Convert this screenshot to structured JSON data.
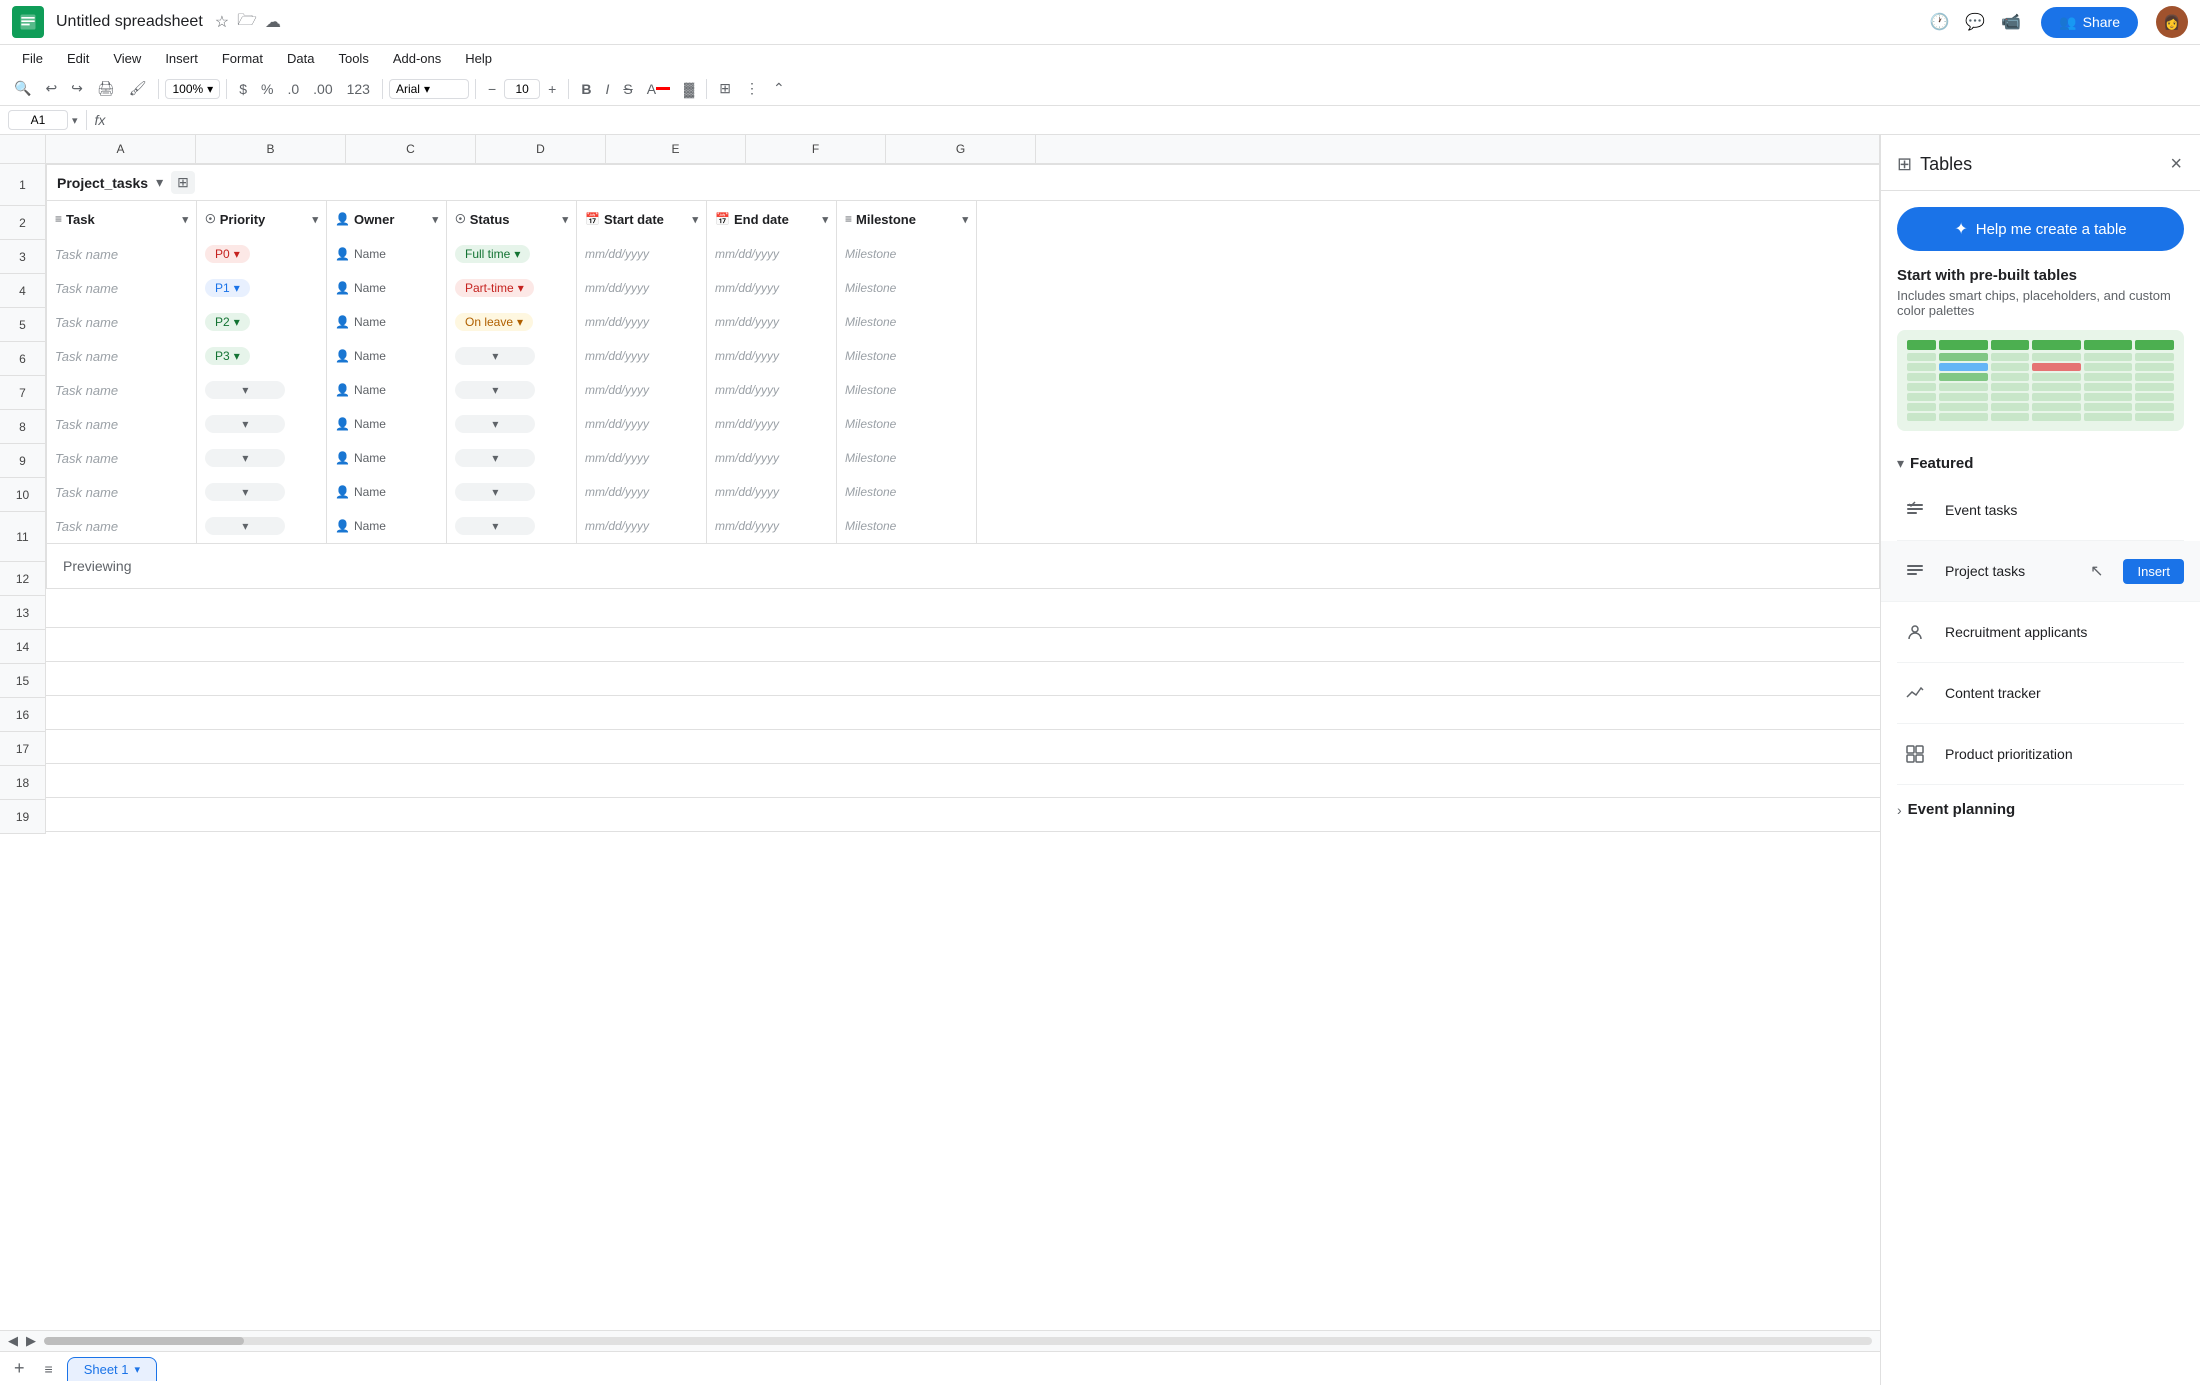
{
  "app": {
    "title": "Untitled spreadsheet",
    "icon_bg": "#0f9d58"
  },
  "menu": {
    "items": [
      "File",
      "Edit",
      "View",
      "Insert",
      "Format",
      "Data",
      "Tools",
      "Add-ons",
      "Help"
    ]
  },
  "toolbar": {
    "zoom": "100%",
    "font": "Arial",
    "font_size": "10",
    "bold": "B",
    "italic": "I",
    "strikethrough": "S̶",
    "more": "⋮"
  },
  "formula_bar": {
    "cell_ref": "A1",
    "fx": "fx"
  },
  "col_headers": [
    "",
    "A",
    "B",
    "C",
    "D",
    "E",
    "F",
    "G"
  ],
  "row_numbers": [
    1,
    2,
    3,
    4,
    5,
    6,
    7,
    8,
    9,
    10,
    11,
    12,
    13,
    14,
    15,
    16,
    17,
    18,
    19
  ],
  "table": {
    "name": "Project_tasks",
    "columns": [
      {
        "icon": "≡",
        "label": "Task",
        "type": "text"
      },
      {
        "icon": "☉",
        "label": "Priority",
        "type": "dropdown"
      },
      {
        "icon": "👤",
        "label": "Owner",
        "type": "person"
      },
      {
        "icon": "☉",
        "label": "Status",
        "type": "dropdown"
      },
      {
        "icon": "📅",
        "label": "Start date",
        "type": "date"
      },
      {
        "icon": "📅",
        "label": "End date",
        "type": "date"
      },
      {
        "icon": "≡",
        "label": "Milestone",
        "type": "text"
      }
    ],
    "rows": [
      {
        "task": "Task name",
        "priority": "P0",
        "priority_color": "p0",
        "owner": "Name",
        "status": "Full time",
        "status_color": "fulltime",
        "start": "mm/dd/yyyy",
        "end": "mm/dd/yyyy",
        "milestone": "Milestone"
      },
      {
        "task": "Task name",
        "priority": "P1",
        "priority_color": "p1",
        "owner": "Name",
        "status": "Part-time",
        "status_color": "parttime",
        "start": "mm/dd/yyyy",
        "end": "mm/dd/yyyy",
        "milestone": "Milestone"
      },
      {
        "task": "Task name",
        "priority": "P2",
        "priority_color": "p2",
        "owner": "Name",
        "status": "On leave",
        "status_color": "onleave",
        "start": "mm/dd/yyyy",
        "end": "mm/dd/yyyy",
        "milestone": "Milestone"
      },
      {
        "task": "Task name",
        "priority": "P3",
        "priority_color": "p3",
        "owner": "Name",
        "status": "",
        "status_color": "empty",
        "start": "mm/dd/yyyy",
        "end": "mm/dd/yyyy",
        "milestone": "Milestone"
      },
      {
        "task": "Task name",
        "priority": "",
        "priority_color": "empty",
        "owner": "Name",
        "status": "",
        "status_color": "empty",
        "start": "mm/dd/yyyy",
        "end": "mm/dd/yyyy",
        "milestone": "Milestone"
      },
      {
        "task": "Task name",
        "priority": "",
        "priority_color": "empty",
        "owner": "Name",
        "status": "",
        "status_color": "empty",
        "start": "mm/dd/yyyy",
        "end": "mm/dd/yyyy",
        "milestone": "Milestone"
      },
      {
        "task": "Task name",
        "priority": "",
        "priority_color": "empty",
        "owner": "Name",
        "status": "",
        "status_color": "empty",
        "start": "mm/dd/yyyy",
        "end": "mm/dd/yyyy",
        "milestone": "Milestone"
      },
      {
        "task": "Task name",
        "priority": "",
        "priority_color": "empty",
        "owner": "Name",
        "status": "",
        "status_color": "empty",
        "start": "mm/dd/yyyy",
        "end": "mm/dd/yyyy",
        "milestone": "Milestone"
      },
      {
        "task": "Task name",
        "priority": "",
        "priority_color": "empty",
        "owner": "Name",
        "status": "",
        "status_color": "empty",
        "start": "mm/dd/yyyy",
        "end": "mm/dd/yyyy",
        "milestone": "Milestone"
      }
    ]
  },
  "previewing_label": "Previewing",
  "sheet_tabs": [
    {
      "label": "Sheet 1",
      "active": true
    }
  ],
  "panel": {
    "title": "Tables",
    "create_btn": "Help me create a table",
    "prebuilt_title": "Start with pre-built tables",
    "prebuilt_desc": "Includes smart chips, placeholders, and custom color palettes",
    "featured_title": "Featured",
    "featured_items": [
      {
        "icon": "checklist",
        "label": "Event tasks",
        "show_insert": false
      },
      {
        "icon": "checklist",
        "label": "Project tasks",
        "show_insert": true,
        "insert_label": "Insert"
      },
      {
        "icon": "person",
        "label": "Recruitment applicants",
        "show_insert": false
      },
      {
        "icon": "analytics",
        "label": "Content tracker",
        "show_insert": false
      },
      {
        "icon": "grid",
        "label": "Product prioritization",
        "show_insert": false
      }
    ],
    "more_section_title": "Event planning",
    "close_label": "×"
  },
  "top_icons": {
    "history": "🕐",
    "comment": "💬",
    "video": "📹"
  }
}
